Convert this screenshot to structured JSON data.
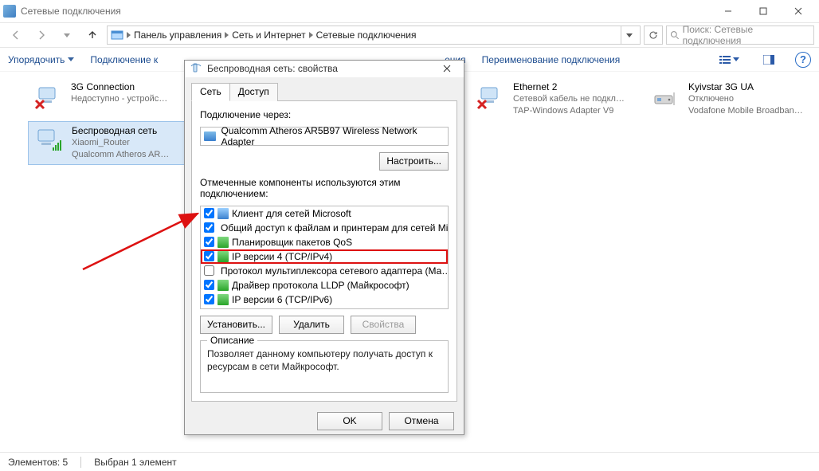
{
  "window": {
    "title": "Сетевые подключения"
  },
  "breadcrumb": {
    "a": "Панель управления",
    "b": "Сеть и Интернет",
    "c": "Сетевые подключения"
  },
  "search": {
    "placeholder": "Поиск: Сетевые подключения"
  },
  "toolbar": {
    "organize": "Упорядочить",
    "connect": "Подключение к",
    "diagnose": "ения",
    "rename": "Переименование подключения"
  },
  "connections": [
    {
      "name": "3G Connection",
      "line2": "Недоступно - устройс…",
      "line3": ""
    },
    {
      "name": "Беспроводная сеть",
      "line2": "Xiaomi_Router",
      "line3": "Qualcomm Atheros AR…"
    },
    {
      "name": "Ethernet 2",
      "line2": "Сетевой кабель не подкл…",
      "line3": "TAP-Windows Adapter V9"
    },
    {
      "name": "Kyivstar 3G UA",
      "line2": "Отключено",
      "line3": "Vodafone Mobile Broadban…"
    }
  ],
  "status": {
    "elements": "Элементов: 5",
    "selected": "Выбран 1 элемент"
  },
  "dialog": {
    "title": "Беспроводная сеть: свойства",
    "tab_network": "Сеть",
    "tab_access": "Доступ",
    "connect_via": "Подключение через:",
    "adapter": "Qualcomm Atheros AR5B97 Wireless Network Adapter",
    "configure": "Настроить...",
    "components_label": "Отмеченные компоненты используются этим подключением:",
    "components": [
      {
        "checked": true,
        "icon": "pc",
        "label": "Клиент для сетей Microsoft"
      },
      {
        "checked": true,
        "icon": "pc",
        "label": "Общий доступ к файлам и принтерам для сетей Mi…"
      },
      {
        "checked": true,
        "icon": "green",
        "label": "Планировщик пакетов QoS"
      },
      {
        "checked": true,
        "icon": "green",
        "label": "IP версии 4 (TCP/IPv4)",
        "highlight": true
      },
      {
        "checked": false,
        "icon": "green",
        "label": "Протокол мультиплексора сетевого адаптера (Ма…"
      },
      {
        "checked": true,
        "icon": "green",
        "label": "Драйвер протокола LLDP (Майкрософт)"
      },
      {
        "checked": true,
        "icon": "green",
        "label": "IP версии 6 (TCP/IPv6)"
      }
    ],
    "install": "Установить...",
    "remove": "Удалить",
    "properties": "Свойства",
    "desc_legend": "Описание",
    "desc_text": "Позволяет данному компьютеру получать доступ к ресурсам в сети Майкрософт.",
    "ok": "OK",
    "cancel": "Отмена"
  }
}
